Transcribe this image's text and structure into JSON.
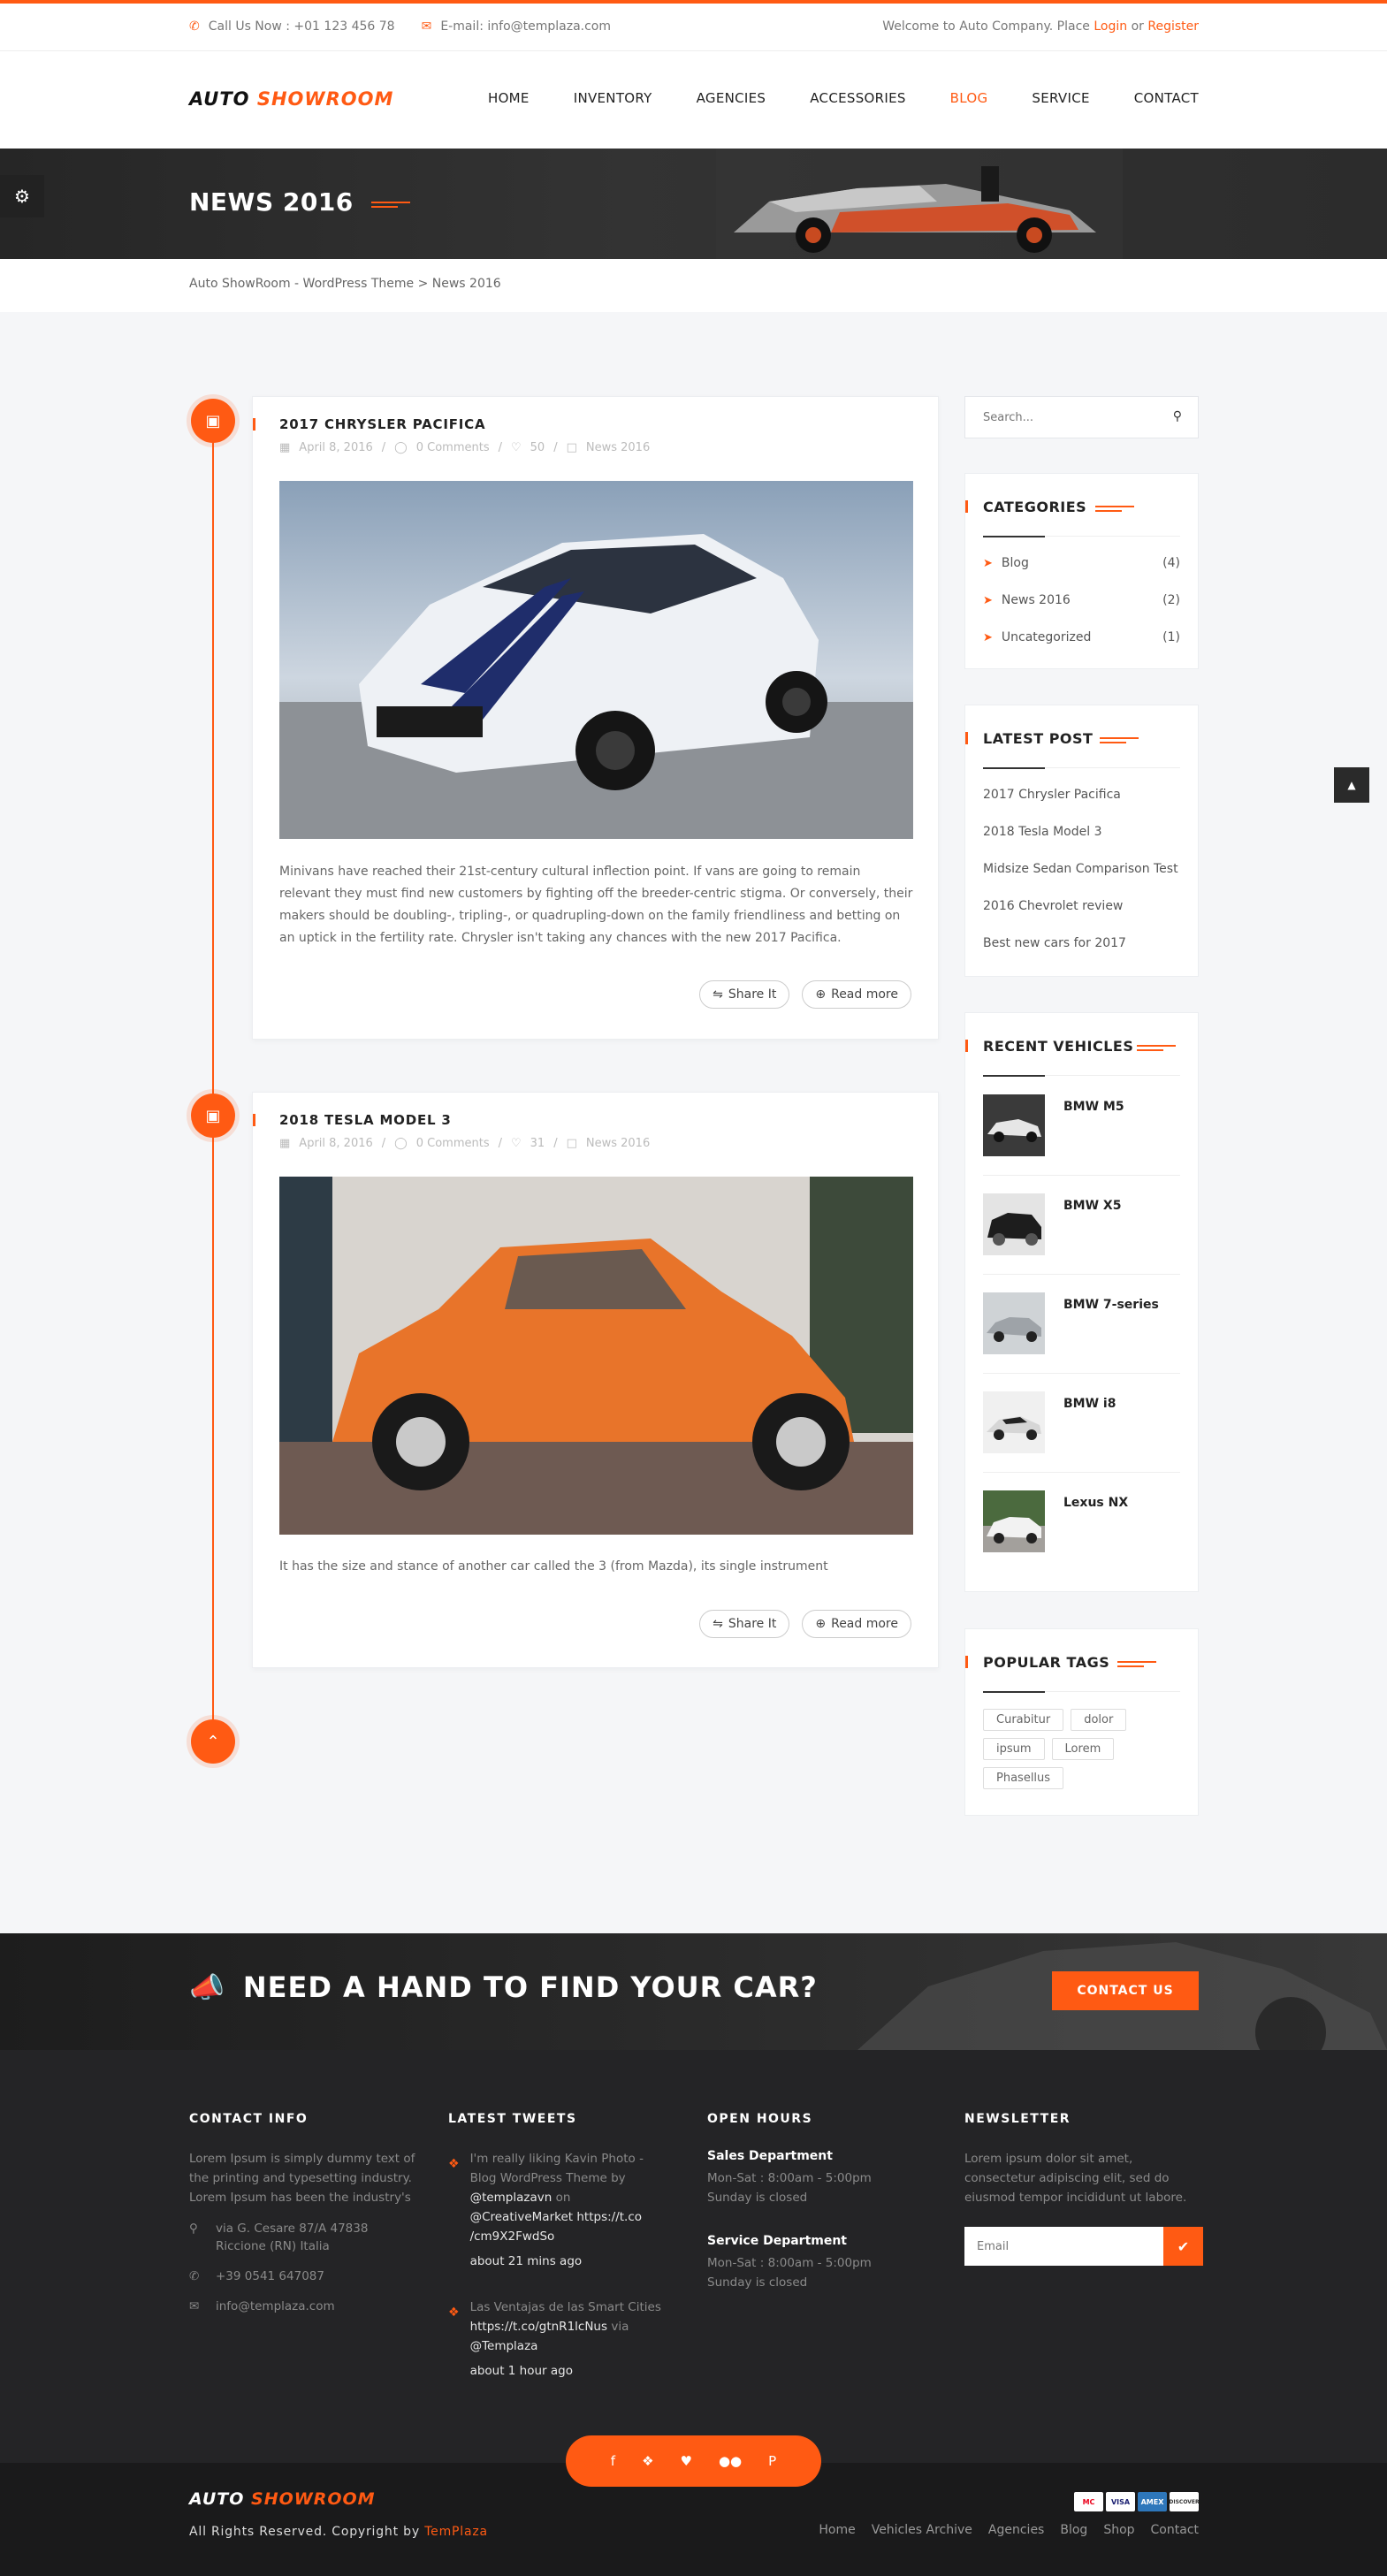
{
  "topbar": {
    "phone": "Call Us Now : +01 123 456 78",
    "email": "E-mail: info@templaza.com",
    "welcome": "Welcome to Auto Company. Place",
    "login": "Login",
    "or": "or",
    "register": "Register"
  },
  "logo": {
    "part1": "AUTO",
    "part2": "SHOWROOM"
  },
  "nav": [
    "HOME",
    "INVENTORY",
    "AGENCIES",
    "ACCESSORIES",
    "BLOG",
    "SERVICE",
    "CONTACT"
  ],
  "nav_active": "BLOG",
  "page_title": "NEWS 2016",
  "breadcrumb": {
    "home": "Auto ShowRoom - WordPress Theme",
    "sep": ">",
    "current": "News 2016"
  },
  "posts": [
    {
      "title": "2017 CHRYSLER PACIFICA",
      "date": "April 8, 2016",
      "comments": "0 Comments",
      "likes": "50",
      "category": "News 2016",
      "excerpt": "Minivans have reached their 21st-century cultural inflection point. If vans are going to remain relevant they must find new customers by fighting off the breeder-centric stigma. Or conversely, their makers should be doubling-, tripling-, or quadrupling-down on the family friendliness and betting on an uptick in the fertility rate. Chrysler isn't taking any chances with the new 2017 Pacifica.",
      "share": "Share It",
      "more": "Read more"
    },
    {
      "title": "2018 TESLA MODEL 3",
      "date": "April 8, 2016",
      "comments": "0 Comments",
      "likes": "31",
      "category": "News 2016",
      "excerpt": "It has the size and stance of another car called the 3 (from Mazda), its single instrument",
      "share": "Share It",
      "more": "Read more"
    }
  ],
  "sidebar": {
    "search_placeholder": "Search...",
    "categories": {
      "title": "CATEGORIES",
      "items": [
        {
          "name": "Blog",
          "count": "(4)"
        },
        {
          "name": "News 2016",
          "count": "(2)"
        },
        {
          "name": "Uncategorized",
          "count": "(1)"
        }
      ]
    },
    "latest": {
      "title": "LATEST POST",
      "items": [
        "2017 Chrysler Pacifica",
        "2018 Tesla Model 3",
        "Midsize Sedan Comparison Test",
        "2016 Chevrolet review",
        "Best new cars for 2017"
      ]
    },
    "vehicles": {
      "title": "RECENT VEHICLES",
      "items": [
        "BMW M5",
        "BMW X5",
        "BMW 7-series",
        "BMW i8",
        "Lexus NX"
      ]
    },
    "tags": {
      "title": "POPULAR TAGS",
      "items": [
        "Curabitur",
        "dolor",
        "ipsum",
        "Lorem",
        "Phasellus"
      ]
    }
  },
  "cta": {
    "text": "NEED A HAND TO FIND YOUR CAR?",
    "button": "CONTACT US"
  },
  "footer": {
    "contact": {
      "title": "CONTACT INFO",
      "text": "Lorem Ipsum is simply dummy text of the printing and typesetting industry. Lorem Ipsum has been the industry's",
      "address1": "via G. Cesare 87/A 47838",
      "address2": "Riccione (RN) Italia",
      "phone": "+39 0541 647087",
      "email": "info@templaza.com"
    },
    "tweets": {
      "title": "LATEST TWEETS",
      "t1_a": "I'm really liking Kavin Photo - Blog WordPress Theme by",
      "t1_b": "@templazavn",
      "t1_c": "on",
      "t1_d": "@CreativeMarket https://t.co /cm9X2FwdSo",
      "t1_time": "about 21 mins ago",
      "t2_a": "Las Ventajas de las Smart Cities",
      "t2_b": "https://t.co/gtnR1lcNus",
      "t2_c": "via",
      "t2_d": "@Templaza",
      "t2_time": "about 1 hour ago"
    },
    "hours": {
      "title": "OPEN HOURS",
      "dep1": "Sales Department",
      "dep1_l1": "Mon-Sat : 8:00am - 5:00pm",
      "dep1_l2": "Sunday is closed",
      "dep2": "Service Department",
      "dep2_l1": "Mon-Sat : 8:00am - 5:00pm",
      "dep2_l2": "Sunday is closed"
    },
    "newsletter": {
      "title": "NEWSLETTER",
      "text": "Lorem ipsum dolor sit amet, consectetur adipiscing elit, sed do eiusmod tempor incididunt ut labore.",
      "placeholder": "Email"
    }
  },
  "bottom": {
    "copy": "All Rights Reserved. Copyright by",
    "brand": "TemPlaza",
    "links": [
      "Home",
      "Vehicles Archive",
      "Agencies",
      "Blog",
      "Shop",
      "Contact"
    ],
    "cards": [
      "MC",
      "VISA",
      "AMEX",
      "DISCOVER"
    ]
  },
  "colors": {
    "accent": "#ff5a13",
    "dark": "#242426"
  }
}
